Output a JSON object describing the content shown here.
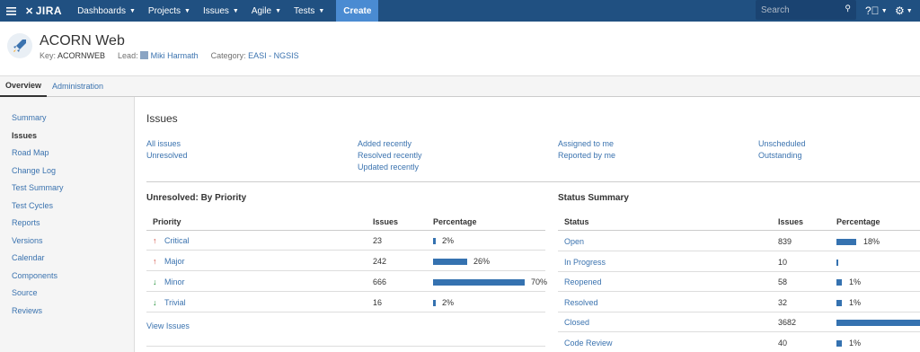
{
  "nav": {
    "logo": "JIRA",
    "items": [
      "Dashboards",
      "Projects",
      "Issues",
      "Agile",
      "Tests"
    ],
    "create": "Create",
    "search_placeholder": "Search"
  },
  "project": {
    "title": "ACORN Web",
    "key_label": "Key:",
    "key": "ACORNWEB",
    "lead_label": "Lead:",
    "lead": "Miki Harmath",
    "category_label": "Category:",
    "category": "EASI - NGSIS"
  },
  "tabs": [
    "Overview",
    "Administration"
  ],
  "sidebar": [
    "Summary",
    "Issues",
    "Road Map",
    "Change Log",
    "Test Summary",
    "Test Cycles",
    "Reports",
    "Versions",
    "Calendar",
    "Components",
    "Source",
    "Reviews"
  ],
  "main": {
    "title": "Issues",
    "filters": {
      "col1": [
        "All issues",
        "Unresolved"
      ],
      "col2": [
        "Added recently",
        "Resolved recently",
        "Updated recently"
      ],
      "col3": [
        "Assigned to me",
        "Reported by me"
      ],
      "col4": [
        "Unscheduled",
        "Outstanding"
      ]
    },
    "priority": {
      "title": "Unresolved: By Priority",
      "headers": [
        "Priority",
        "Issues",
        "Percentage"
      ],
      "rows": [
        {
          "name": "Critical",
          "dir": "up",
          "count": "23",
          "pct": "2%",
          "value": 2
        },
        {
          "name": "Major",
          "dir": "up",
          "count": "242",
          "pct": "26%",
          "value": 26
        },
        {
          "name": "Minor",
          "dir": "down",
          "count": "666",
          "pct": "70%",
          "value": 70
        },
        {
          "name": "Trivial",
          "dir": "down",
          "count": "16",
          "pct": "2%",
          "value": 2
        }
      ],
      "view_link": "View Issues"
    },
    "status": {
      "title": "Status Summary",
      "headers": [
        "Status",
        "Issues",
        "Percentage"
      ],
      "rows": [
        {
          "name": "Open",
          "count": "839",
          "pct": "18%",
          "value": 18
        },
        {
          "name": "In Progress",
          "count": "10",
          "pct": "",
          "value": 0.2
        },
        {
          "name": "Reopened",
          "count": "58",
          "pct": "1%",
          "value": 1
        },
        {
          "name": "Resolved",
          "count": "32",
          "pct": "1%",
          "value": 1
        },
        {
          "name": "Closed",
          "count": "3682",
          "pct": "",
          "value": 80
        },
        {
          "name": "Code Review",
          "count": "40",
          "pct": "1%",
          "value": 1
        }
      ]
    }
  },
  "colors": {
    "nav_bg": "#205081",
    "link": "#3b73af",
    "bar": "#3572b0",
    "priority_up": "#d04437",
    "priority_down": "#14892c"
  }
}
